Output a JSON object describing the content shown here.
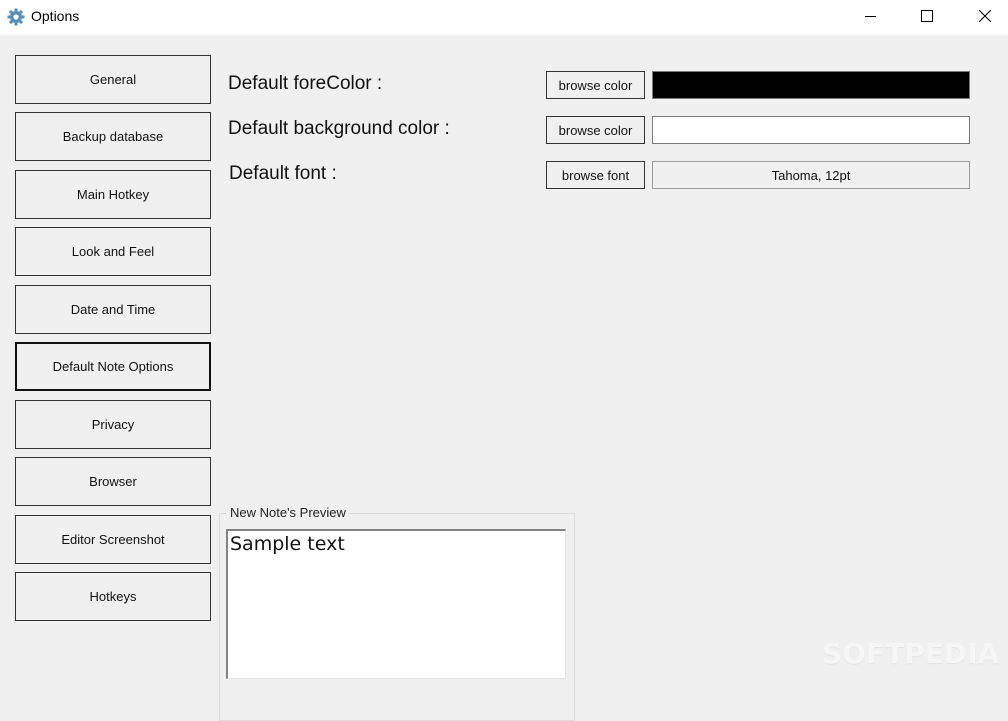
{
  "window": {
    "title": "Options",
    "app_icon": "gear-icon",
    "controls": {
      "minimize_icon": "minimize-icon",
      "maximize_icon": "maximize-icon",
      "close_icon": "close-icon"
    }
  },
  "sidebar": {
    "active_index": 5,
    "items": [
      {
        "label": "General"
      },
      {
        "label": "Backup database"
      },
      {
        "label": "Main Hotkey"
      },
      {
        "label": "Look and Feel"
      },
      {
        "label": "Date and Time"
      },
      {
        "label": "Default Note Options"
      },
      {
        "label": "Privacy"
      },
      {
        "label": "Browser"
      },
      {
        "label": "Editor Screenshot"
      },
      {
        "label": "Hotkeys"
      }
    ]
  },
  "settings": {
    "fore_color": {
      "label": "Default foreColor :",
      "button_label": "browse color",
      "value_color": "#000000"
    },
    "background_color": {
      "label": "Default background color :",
      "button_label": "browse color",
      "value_color": "#ffffff"
    },
    "font": {
      "label": "Default font :",
      "button_label": "browse font",
      "value": "Tahoma, 12pt"
    }
  },
  "preview": {
    "group_label": "New Note's Preview",
    "text": "Sample text"
  },
  "watermark": "SOFTPEDIA"
}
